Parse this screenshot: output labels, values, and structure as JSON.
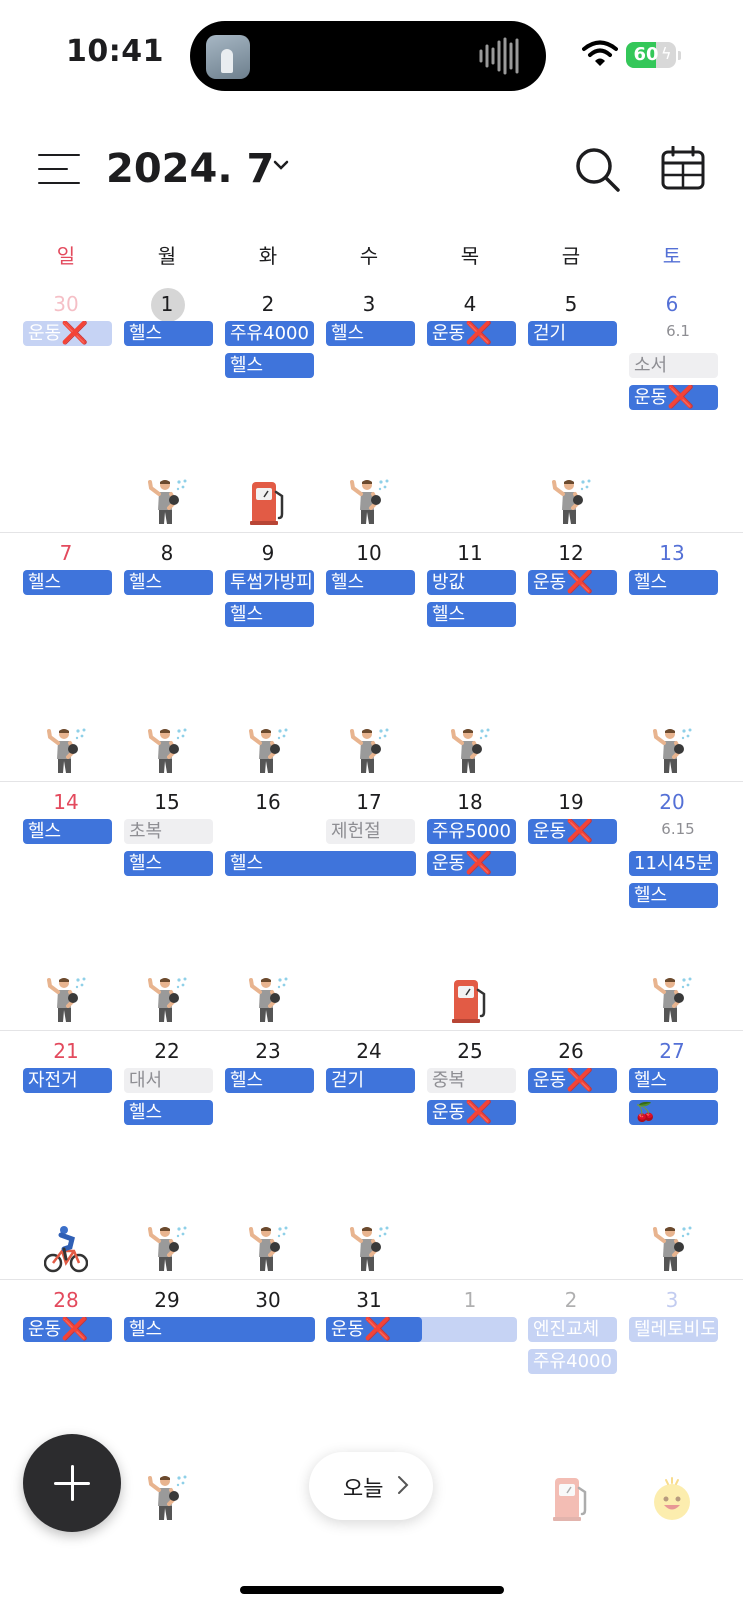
{
  "status_bar": {
    "time": "10:41",
    "battery": "60"
  },
  "header": {
    "title": "2024. 7"
  },
  "weekdays": [
    "일",
    "월",
    "화",
    "수",
    "목",
    "금",
    "토"
  ],
  "colors": {
    "sunday": "#e34a5d",
    "saturday": "#5470d6",
    "event": "#3f74db",
    "event_gray": "#efeff1",
    "cancel_x": "#e0202b"
  },
  "weeks": [
    {
      "days": [
        "30",
        "1",
        "2",
        "3",
        "4",
        "5",
        "6"
      ],
      "lunar": {
        "6": "6.1"
      }
    },
    {
      "days": [
        "7",
        "8",
        "9",
        "10",
        "11",
        "12",
        "13"
      ],
      "lunar": {}
    },
    {
      "days": [
        "14",
        "15",
        "16",
        "17",
        "18",
        "19",
        "20"
      ],
      "lunar": {
        "6": "6.15"
      }
    },
    {
      "days": [
        "21",
        "22",
        "23",
        "24",
        "25",
        "26",
        "27"
      ],
      "lunar": {}
    },
    {
      "days": [
        "28",
        "29",
        "30",
        "31",
        "1",
        "2",
        "3"
      ],
      "lunar": {}
    }
  ],
  "events": {
    "w0_sun": "운동",
    "w0_mon": "헬스",
    "w0_tue1": "주유4000",
    "w0_tue2": "헬스",
    "w0_wed": "헬스",
    "w0_thu": "운동",
    "w0_fri": "걷기",
    "w0_sat1": "소서",
    "w0_sat2": "운동",
    "w1_sun": "헬스",
    "w1_mon": "헬스",
    "w1_tue1": "투썸가방피",
    "w1_tue2": "헬스",
    "w1_wed": "헬스",
    "w1_thu1": "방값",
    "w1_thu2": "헬스",
    "w1_fri": "운동",
    "w1_sat": "헬스",
    "w2_sun": "헬스",
    "w2_mon1": "초복",
    "w2_mon2": "헬스",
    "w2_tuewed": "헬스",
    "w2_wed": "제헌절",
    "w2_thu1": "주유5000",
    "w2_thu2": "운동",
    "w2_fri": "운동",
    "w2_sat1": "11시45분",
    "w2_sat2": "헬스",
    "w3_sun": "자전거",
    "w3_mon1": "대서",
    "w3_mon2": "헬스",
    "w3_tue": "헬스",
    "w3_wed": "걷기",
    "w3_thu1": "중복",
    "w3_thu2": "운동",
    "w3_fri": "운동",
    "w3_sat1": "헬스",
    "w3_sat2": "🍒",
    "w4_sun": "운동",
    "w4_montue": "헬스",
    "w4_wed": "운동",
    "w4_fri1": "엔진교체",
    "w4_fri2": "주유4000",
    "w4_sat": "텔레토비도"
  },
  "cancel_mark": "❌",
  "stickers": {
    "workout": "weightlifter-sticker",
    "fuel": "fuel-pump-sticker",
    "cycling": "cyclist-sticker",
    "smile": "smiley-sticker"
  },
  "today_button": "오늘"
}
